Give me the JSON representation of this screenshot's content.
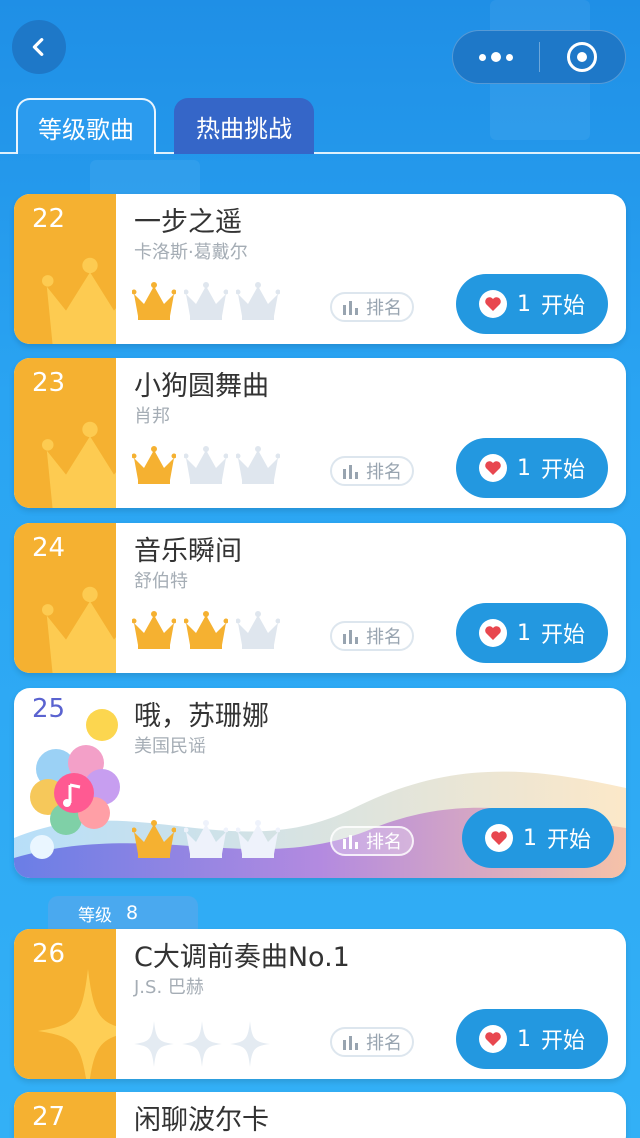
{
  "nav": {
    "back_icon": "chevron-left-icon",
    "more_icon": "more-dots-icon",
    "close_icon": "target-icon"
  },
  "tabs": [
    {
      "label": "等级歌曲",
      "active": true
    },
    {
      "label": "热曲挑战",
      "active": false
    }
  ],
  "songs": [
    {
      "index": "22",
      "title": "一步之遥",
      "artist": "卡洛斯·葛戴尔",
      "crowns_earned": 1,
      "crowns_total": 3,
      "rank_label": "排名",
      "start_count": "1",
      "start_label": "开始"
    },
    {
      "index": "23",
      "title": "小狗圆舞曲",
      "artist": "肖邦",
      "crowns_earned": 1,
      "crowns_total": 3,
      "rank_label": "排名",
      "start_count": "1",
      "start_label": "开始"
    },
    {
      "index": "24",
      "title": "音乐瞬间",
      "artist": "舒伯特",
      "crowns_earned": 2,
      "crowns_total": 3,
      "rank_label": "排名",
      "start_count": "1",
      "start_label": "开始"
    },
    {
      "index": "25",
      "title": "哦，苏珊娜",
      "artist": "美国民谣",
      "crowns_earned": 1,
      "crowns_total": 3,
      "rank_label": "排名",
      "start_count": "1",
      "start_label": "开始"
    },
    {
      "index": "26",
      "title": "C大调前奏曲No.1",
      "artist": "J.S. 巴赫",
      "stars_earned": 0,
      "stars_total": 3,
      "rank_label": "排名",
      "start_count": "1",
      "start_label": "开始"
    },
    {
      "index": "27",
      "title": "闲聊波尔卡"
    }
  ],
  "level": {
    "label": "等级",
    "value": "8"
  },
  "colors": {
    "background": "#2aa4f2",
    "card_side": "#f5b131",
    "start_button": "#2398e0",
    "crown_gold": "#f5b131",
    "crown_empty": "#dfe6ee",
    "heart": "#e8474f"
  }
}
